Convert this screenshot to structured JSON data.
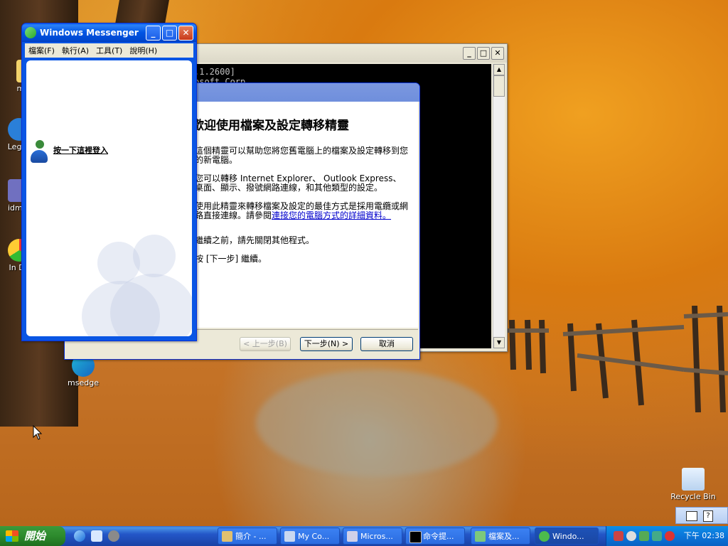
{
  "desktop_icons": [
    {
      "name": "mypa"
    },
    {
      "name": "Legac"
    },
    {
      "name": "idmar"
    },
    {
      "name": "In Do"
    },
    {
      "name": "msedge"
    },
    {
      "name": "Recycle Bin"
    }
  ],
  "console": {
    "lines": [
      ".1.2600]",
      "osoft Corp."
    ]
  },
  "wizard": {
    "heading": "歡迎使用檔案及設定轉移精靈",
    "p1": "這個精靈可以幫助您將您舊電腦上的檔案及設定轉移到您的新電腦。",
    "p2": "您可以轉移 Internet Explorer、 Outlook Express、桌面、顯示、撥號網路連線，和其他類型的設定。",
    "p3_text": "使用此精靈來轉移檔案及設定的最佳方式是採用電纜或網路直接連線。請參閱",
    "p3_link": "連接您的電腦方式的詳細資料。",
    "p4": "繼續之前，請先關閉其他程式。",
    "p5": "按 [下一步] 繼續。",
    "back_label": "< 上一步(B)",
    "next_label": "下一步(N) >",
    "cancel_label": "取消"
  },
  "messenger": {
    "title": "Windows Messenger",
    "menu": [
      "檔案(F)",
      "執行(A)",
      "工具(T)",
      "說明(H)"
    ],
    "signin": "按一下這裡登入"
  },
  "taskbar": {
    "start_label": "開始",
    "tasks": [
      {
        "label": "簡介 - ..."
      },
      {
        "label": "My Co..."
      },
      {
        "label": "Micros..."
      },
      {
        "label": "命令提..."
      },
      {
        "label": "檔案及..."
      },
      {
        "label": "Windo..."
      }
    ],
    "clock": "下午 02:38"
  },
  "colors": {
    "xp_blue": "#0054e3",
    "start_green": "#2d8a2d",
    "link": "#0000cc"
  }
}
